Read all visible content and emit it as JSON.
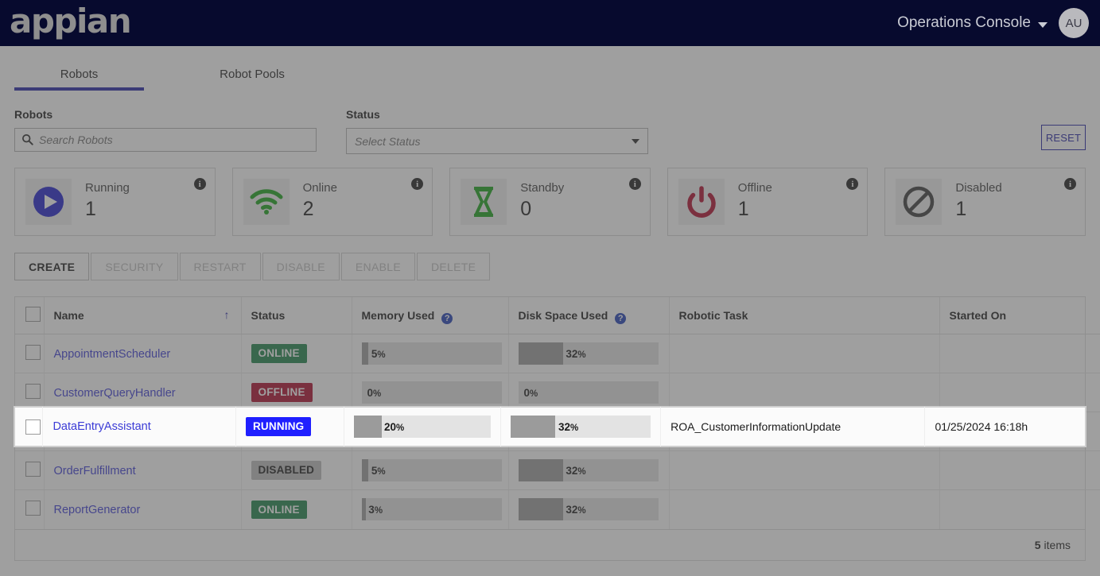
{
  "appbar": {
    "brand": "appian",
    "console_label": "Operations Console",
    "avatar_initials": "AU"
  },
  "tabs": [
    {
      "label": "Robots",
      "active": true
    },
    {
      "label": "Robot Pools",
      "active": false
    }
  ],
  "filters": {
    "robots_label": "Robots",
    "search_placeholder": "Search Robots",
    "search_value": "",
    "status_label": "Status",
    "status_value": "Select Status",
    "reset_label": "RESET"
  },
  "cards": [
    {
      "label": "Running",
      "value": "1",
      "icon": "play-circle-icon",
      "color": "#1f1fcc",
      "info": "i"
    },
    {
      "label": "Online",
      "value": "2",
      "icon": "wifi-icon",
      "color": "#19a319",
      "info": "i"
    },
    {
      "label": "Standby",
      "value": "0",
      "icon": "hourglass-icon",
      "color": "#19a319",
      "info": "i"
    },
    {
      "label": "Offline",
      "value": "1",
      "icon": "power-icon",
      "color": "#b00b2b",
      "info": "i"
    },
    {
      "label": "Disabled",
      "value": "1",
      "icon": "no-entry-icon",
      "color": "#3a3a3a",
      "info": "i"
    }
  ],
  "actions": [
    {
      "label": "CREATE",
      "enabled": true
    },
    {
      "label": "SECURITY",
      "enabled": false
    },
    {
      "label": "RESTART",
      "enabled": false
    },
    {
      "label": "DISABLE",
      "enabled": false
    },
    {
      "label": "ENABLE",
      "enabled": false
    },
    {
      "label": "DELETE",
      "enabled": false
    }
  ],
  "table": {
    "columns": [
      {
        "label": "Name",
        "sort": "asc",
        "help": false
      },
      {
        "label": "Status",
        "sort": null,
        "help": false
      },
      {
        "label": "Memory Used",
        "sort": null,
        "help": true
      },
      {
        "label": "Disk Space Used",
        "sort": null,
        "help": true
      },
      {
        "label": "Robotic Task",
        "sort": null,
        "help": false
      },
      {
        "label": "Started On",
        "sort": null,
        "help": false
      }
    ],
    "help_glyph": "?",
    "sort_glyph": "↑",
    "rows": [
      {
        "name": "AppointmentScheduler",
        "status": "ONLINE",
        "status_kind": "online",
        "memory": "5%",
        "memory_pct": 5,
        "disk": "32%",
        "disk_pct": 32,
        "task": "",
        "started": ""
      },
      {
        "name": "CustomerQueryHandler",
        "status": "OFFLINE",
        "status_kind": "offline",
        "memory": "0%",
        "memory_pct": 0,
        "disk": "0%",
        "disk_pct": 0,
        "task": "",
        "started": ""
      },
      {
        "name": "DataEntryAssistant",
        "status": "RUNNING",
        "status_kind": "running",
        "memory": "20%",
        "memory_pct": 20,
        "disk": "32%",
        "disk_pct": 32,
        "task": "ROA_CustomerInformationUpdate",
        "started": "01/25/2024 16:18h"
      },
      {
        "name": "OrderFulfillment",
        "status": "DISABLED",
        "status_kind": "disabled",
        "memory": "5%",
        "memory_pct": 5,
        "disk": "32%",
        "disk_pct": 32,
        "task": "",
        "started": ""
      },
      {
        "name": "ReportGenerator",
        "status": "ONLINE",
        "status_kind": "online",
        "memory": "3%",
        "memory_pct": 3,
        "disk": "32%",
        "disk_pct": 32,
        "task": "",
        "started": ""
      }
    ],
    "footer_count": "5",
    "footer_label": "items"
  },
  "highlighted_row_index": 2
}
